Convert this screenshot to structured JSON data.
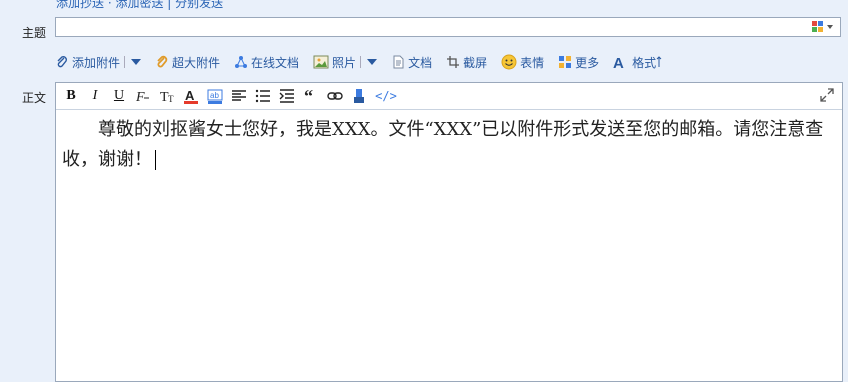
{
  "top_links": {
    "text": "添加抄送 · 添加密送 | 分别发送"
  },
  "form": {
    "subject_label": "主题",
    "subject_value": "",
    "body_label": "正文"
  },
  "attach_bar": {
    "add_attachment": "添加附件",
    "large_attachment": "超大附件",
    "online_doc": "在线文档",
    "photo": "照片",
    "doc": "文档",
    "screenshot": "截屏",
    "emoji": "表情",
    "more": "更多",
    "format": "格式"
  },
  "editor_toolbar": {
    "html_label": "</>"
  },
  "body": {
    "text": "尊敬的刘抠酱女士您好，我是XXX。文件“XXX”已以附件形式发送至您的邮箱。请您注意查收，谢谢！"
  },
  "colors": {
    "accent_blue": "#2a5aa0",
    "page_bg": "#e9f0fa",
    "border": "#9aa8bb"
  }
}
